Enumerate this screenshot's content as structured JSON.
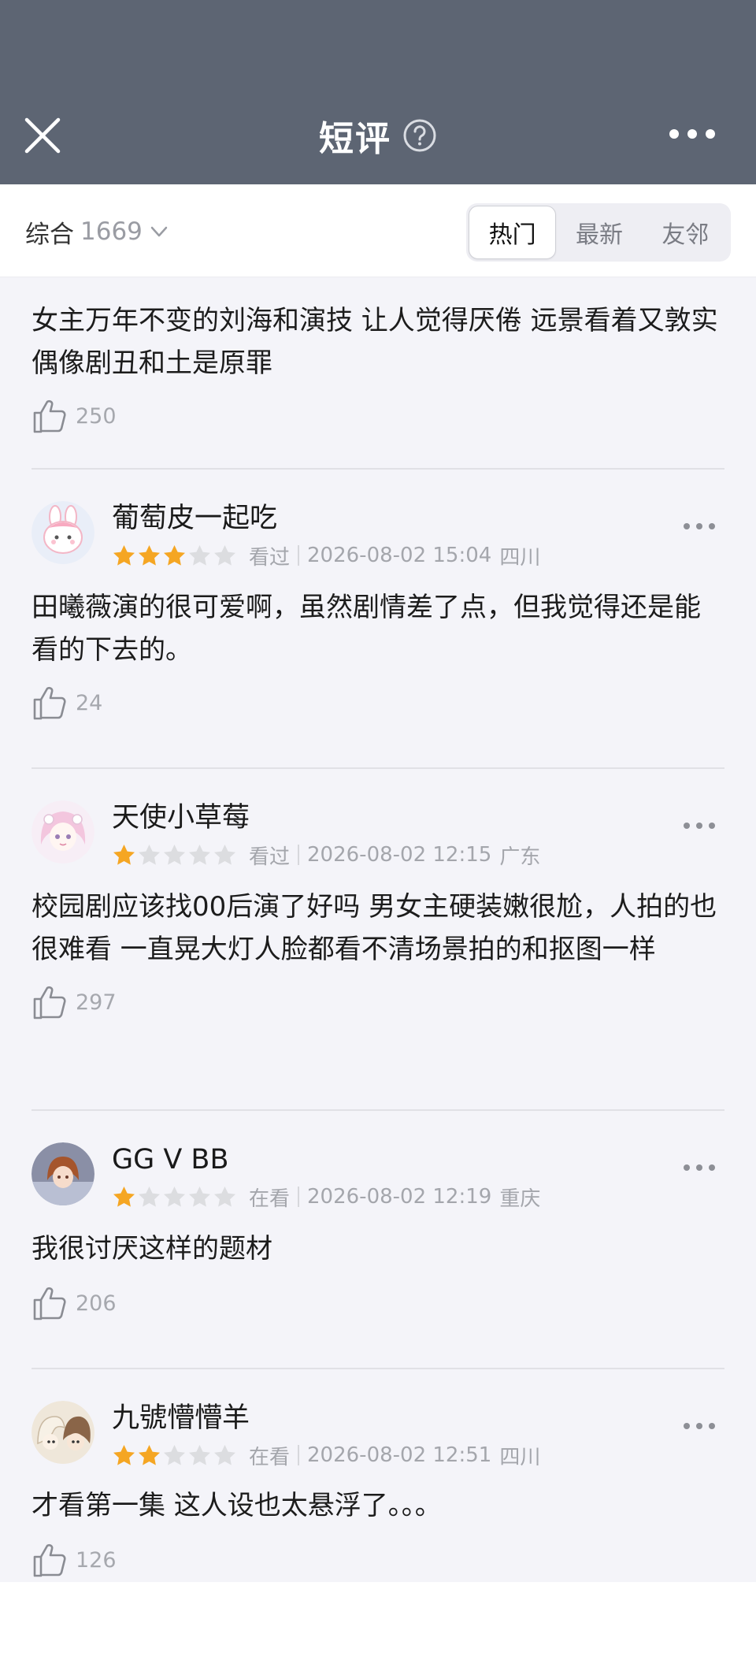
{
  "header": {
    "title": "短评",
    "background_color": "#5d6573"
  },
  "filter": {
    "sort_label": "综合",
    "count": "1669",
    "tabs": [
      {
        "label": "热门",
        "active": true
      },
      {
        "label": "最新",
        "active": false
      },
      {
        "label": "友邻",
        "active": false
      }
    ]
  },
  "reviews": [
    {
      "text": "女主万年不变的刘海和演技 让人觉得厌倦 远景看着又敦实 偶像剧丑和土是原罪",
      "likes": "250"
    },
    {
      "username": "葡萄皮一起吃",
      "rating": 3,
      "status": "看过",
      "time": "2026-08-02 15:04",
      "location": "四川",
      "text": "田曦薇演的很可爱啊，虽然剧情差了点，但我觉得还是能看的下去的。",
      "likes": "24"
    },
    {
      "username": "天使小草莓",
      "rating": 1,
      "status": "看过",
      "time": "2026-08-02 12:15",
      "location": "广东",
      "text": "校园剧应该找00后演了好吗 男女主硬装嫩很尬，人拍的也很难看 一直晃大灯人脸都看不清场景拍的和抠图一样",
      "likes": "297"
    },
    {
      "username": "GG V BB",
      "rating": 1,
      "status": "在看",
      "time": "2026-08-02 12:19",
      "location": "重庆",
      "text": "我很讨厌这样的题材",
      "likes": "206"
    },
    {
      "username": "九號懵懵羊",
      "rating": 2,
      "status": "在看",
      "time": "2026-08-02 12:51",
      "location": "四川",
      "text": "才看第一集 这人设也太悬浮了。。。",
      "likes": "126"
    }
  ],
  "colors": {
    "star_on": "#f5a623",
    "star_off": "#dcdde0",
    "content_bg": "#f4f4f9"
  }
}
